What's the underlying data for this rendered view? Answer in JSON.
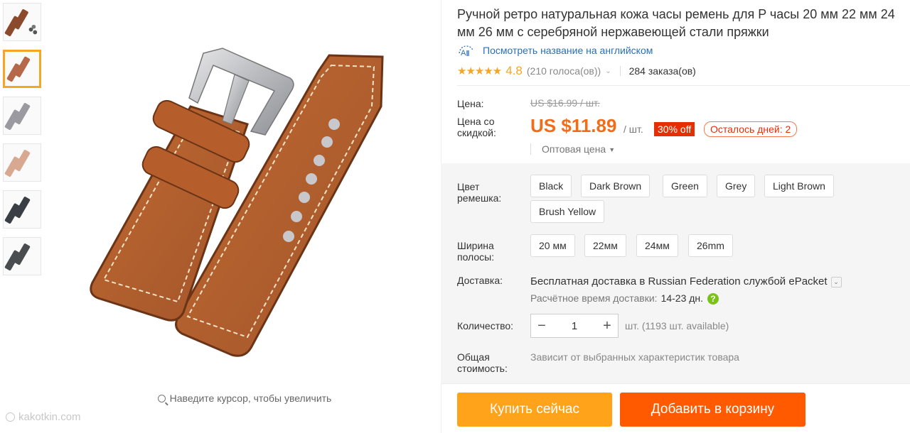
{
  "product": {
    "title": "Ручной ретро натуральная кожа часы ремень для P часы 20 мм 22 мм 24 мм 26 мм с серебряной нержавеющей стали пряжки",
    "translate_link": "Посмотреть название на английском",
    "translate_icon_text": "A",
    "rating_stars": "★★★★★",
    "rating_value": "4.8",
    "votes": "(210 голоса(ов))",
    "orders": "284 заказа(ов)"
  },
  "gallery": {
    "zoom_hint": "Наведите курсор, чтобы увеличить",
    "watermark": "kakotkin.com",
    "thumb_colors": [
      "#8b4a2b",
      "#b5684a",
      "#9a9aa0",
      "#d8a890",
      "#3a3e45",
      "#4a4d50"
    ],
    "active_thumb": 1
  },
  "price": {
    "price_label": "Цена:",
    "old_price": "US $16.99 / шт.",
    "discount_label": "Цена со скидкой:",
    "new_price": "US $11.89",
    "per_unit": "/ шт.",
    "discount_badge": "30% off",
    "days_left": "Осталось дней: 2",
    "wholesale": "Оптовая цена"
  },
  "options": {
    "color_label": "Цвет ремешка:",
    "colors": [
      "Black",
      "Dark Brown",
      "Green",
      "Grey",
      "Light Brown",
      "Brush Yellow"
    ],
    "width_label": "Ширина полосы:",
    "widths": [
      "20 мм",
      "22мм",
      "24мм",
      "26mm"
    ]
  },
  "shipping": {
    "label": "Доставка:",
    "free": "Бесплатная доставка в",
    "destination": "Russian Federation службой ePacket",
    "time_label": "Расчётное время доставки:",
    "time_value": "14-23  дн.",
    "help": "?"
  },
  "quantity": {
    "label": "Количество:",
    "value": "1",
    "minus": "−",
    "plus": "+",
    "available": "шт. (1193 шт. available)"
  },
  "total": {
    "label": "Общая стоимость:",
    "note": "Зависит от выбранных характеристик товара"
  },
  "actions": {
    "buy_now": "Купить сейчас",
    "add_to_cart": "Добавить в корзину"
  },
  "colors": {
    "accent_orange": "#f36d18",
    "buy_button": "#ffa31a",
    "cart_button": "#ff5a00",
    "discount_red": "#e62e04",
    "link_blue": "#2a6fb8",
    "star": "#f5a623"
  }
}
